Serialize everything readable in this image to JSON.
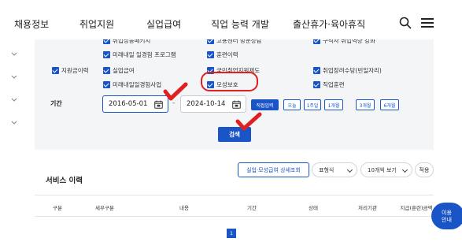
{
  "topnav": {
    "items": [
      "채용정보",
      "취업지원",
      "실업급여",
      "직업 능력 개발",
      "출산휴가·육아휴직"
    ],
    "search_icon": "search-icon",
    "menu_icon": "hamburger-menu-icon"
  },
  "filters": {
    "partial_row": [
      "취업성공패키지",
      "고용센터 방문상담",
      "구직자 취업역량 강화"
    ],
    "row1": [
      "미래내일 일경험 프로그램",
      "훈련이력"
    ],
    "group_label": "지원금이력",
    "row2": [
      "실업급여",
      "국민취업지원제도",
      "취업장려수당(빈일자리)"
    ],
    "row3": [
      "미래내일일경험사업",
      "모성보호",
      "직업훈련"
    ],
    "period_label": "기간",
    "start_date": "2016-05-01",
    "end_date": "2024-10-14",
    "date_separator": "-",
    "quick_buttons": [
      "직접입력",
      "오늘",
      "1주일",
      "1개월",
      "3개월",
      "6개월"
    ],
    "search_button": "검색"
  },
  "history": {
    "title": "서비스 이력",
    "detail_button": "실업·모성급여 상세조회",
    "view_format_label": "표형식",
    "per_page_label": "10개씩 보기",
    "apply_label": "적용",
    "columns": [
      "구분",
      "세부구분",
      "내용",
      "기간",
      "상태",
      "처리기관",
      "지급(훈련)금액"
    ]
  },
  "pagination": {
    "current": "1"
  },
  "floating_help": {
    "line1": "이용",
    "line2": "안내"
  },
  "colors": {
    "accent": "#1a55c8",
    "highlight": "#e02020",
    "panel": "#f4f5f7"
  }
}
